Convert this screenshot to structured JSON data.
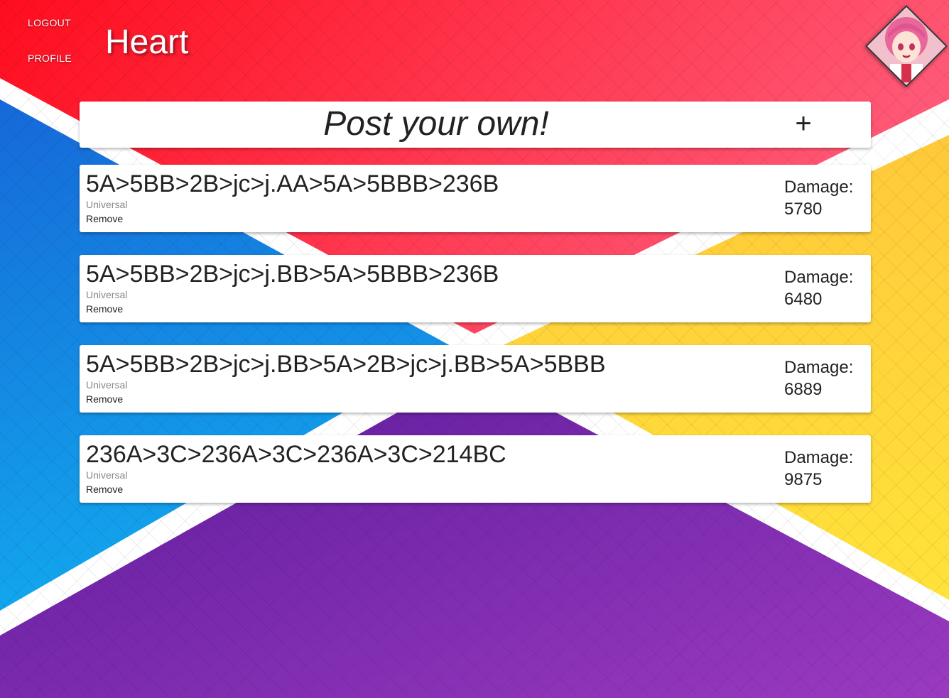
{
  "nav": {
    "logout": "LOGOUT",
    "profile": "PROFILE"
  },
  "header": {
    "title": "Heart"
  },
  "avatar": {
    "icon": "character-portrait-icon"
  },
  "post": {
    "label": "Post your own!",
    "add_icon": "+"
  },
  "combos": [
    {
      "sequence": "5A>5BB>2B>jc>j.AA>5A>5BBB>236B",
      "category": "Universal",
      "remove": "Remove",
      "damage_label": "Damage:",
      "damage": "5780"
    },
    {
      "sequence": "5A>5BB>2B>jc>j.BB>5A>5BBB>236B",
      "category": "Universal",
      "remove": "Remove",
      "damage_label": "Damage:",
      "damage": "6480"
    },
    {
      "sequence": "5A>5BB>2B>jc>j.BB>5A>2B>jc>j.BB>5A>5BBB",
      "category": "Universal",
      "remove": "Remove",
      "damage_label": "Damage:",
      "damage": "6889"
    },
    {
      "sequence": "236A>3C>236A>3C>236A>3C>214BC",
      "category": "Universal",
      "remove": "Remove",
      "damage_label": "Damage:",
      "damage": "9875"
    }
  ],
  "colors": {
    "red": "#ff1a2e",
    "blue": "#1a8fe8",
    "yellow": "#ffd233",
    "purple": "#7a28b0"
  }
}
